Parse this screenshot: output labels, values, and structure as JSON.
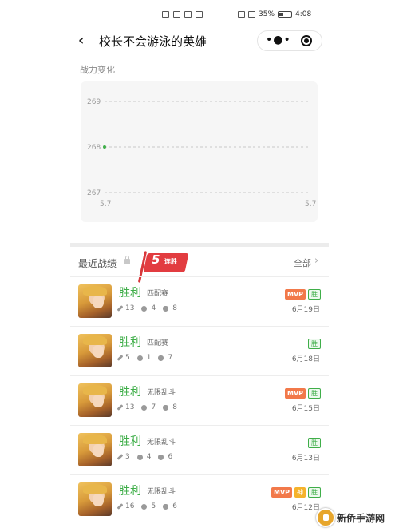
{
  "status_bar": {
    "battery": "35%",
    "time": "4:08"
  },
  "nav": {
    "title": "校长不会游泳的英雄"
  },
  "power_section": {
    "title": "战力变化"
  },
  "chart_data": {
    "type": "line",
    "title": "",
    "xlabel": "",
    "ylabel": "",
    "y_ticks": [
      "269",
      "268",
      "267"
    ],
    "x_ticks": [
      "5.7",
      "5.7"
    ],
    "ylim": [
      267,
      269
    ],
    "grid": true,
    "series": [
      {
        "values": [
          268
        ]
      }
    ],
    "colors": {
      "point": "#3fae49",
      "grid": "#c8c8c8"
    }
  },
  "recent": {
    "title": "最近战绩",
    "streak_number": "5",
    "streak_text": "连胜",
    "all_label": "全部"
  },
  "matches": [
    {
      "result": "胜利",
      "mode": "匹配赛",
      "kills": "13",
      "deaths": "4",
      "assists": "8",
      "badges": [
        "MVP",
        "胜"
      ],
      "date": "6月19日"
    },
    {
      "result": "胜利",
      "mode": "匹配赛",
      "kills": "5",
      "deaths": "1",
      "assists": "7",
      "badges": [
        "胜"
      ],
      "date": "6月18日"
    },
    {
      "result": "胜利",
      "mode": "无限乱斗",
      "kills": "13",
      "deaths": "7",
      "assists": "8",
      "badges": [
        "MVP",
        "胜"
      ],
      "date": "6月15日"
    },
    {
      "result": "胜利",
      "mode": "无限乱斗",
      "kills": "3",
      "deaths": "4",
      "assists": "6",
      "badges": [
        "胜"
      ],
      "date": "6月13日"
    },
    {
      "result": "胜利",
      "mode": "无限乱斗",
      "kills": "16",
      "deaths": "5",
      "assists": "6",
      "badges": [
        "MVP",
        "神",
        "胜"
      ],
      "date": "6月12日"
    }
  ],
  "watermark": {
    "text": "新侨手游网"
  },
  "colors": {
    "win": "#3fae49",
    "mvp": "#f2794a",
    "streak_flag": "#e23c40"
  }
}
